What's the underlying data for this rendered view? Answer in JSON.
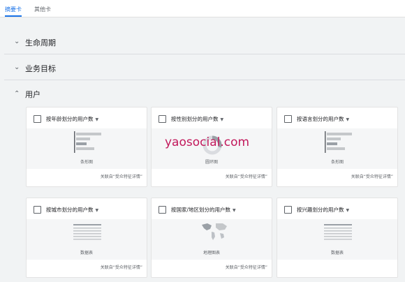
{
  "tabs": [
    {
      "label": "摘要卡",
      "active": true
    },
    {
      "label": "其他卡",
      "active": false
    }
  ],
  "sections": [
    {
      "label": "生命周期",
      "expanded": false,
      "icon": "chevron-down-icon"
    },
    {
      "label": "业务目标",
      "expanded": false,
      "icon": "chevron-down-icon"
    },
    {
      "label": "用户",
      "expanded": true,
      "icon": "chevron-up-icon"
    }
  ],
  "cards": [
    {
      "title": "按年龄划分的用户数",
      "chart_label": "条形图",
      "footer": "关联自“受众特征详情”",
      "chart": "bar"
    },
    {
      "title": "按性别划分的用户数",
      "chart_label": "圆环图",
      "footer": "关联自“受众特征详情”",
      "chart": "donut"
    },
    {
      "title": "按语言划分的用户数",
      "chart_label": "条形图",
      "footer": "关联自“受众特征详情”",
      "chart": "bar"
    },
    {
      "title": "按城市划分的用户数",
      "chart_label": "数据表",
      "footer": "关联自“受众特征详情”",
      "chart": "table"
    },
    {
      "title": "按国家/地区划分的用户数",
      "chart_label": "地理图表",
      "footer": "关联自“受众特征详情”",
      "chart": "map"
    },
    {
      "title": "按兴趣划分的用户数",
      "chart_label": "数据表",
      "footer": "",
      "chart": "table"
    }
  ],
  "watermark": "yaosocial.com",
  "colors": {
    "accent": "#1a73e8",
    "watermark": "#c2185b"
  }
}
